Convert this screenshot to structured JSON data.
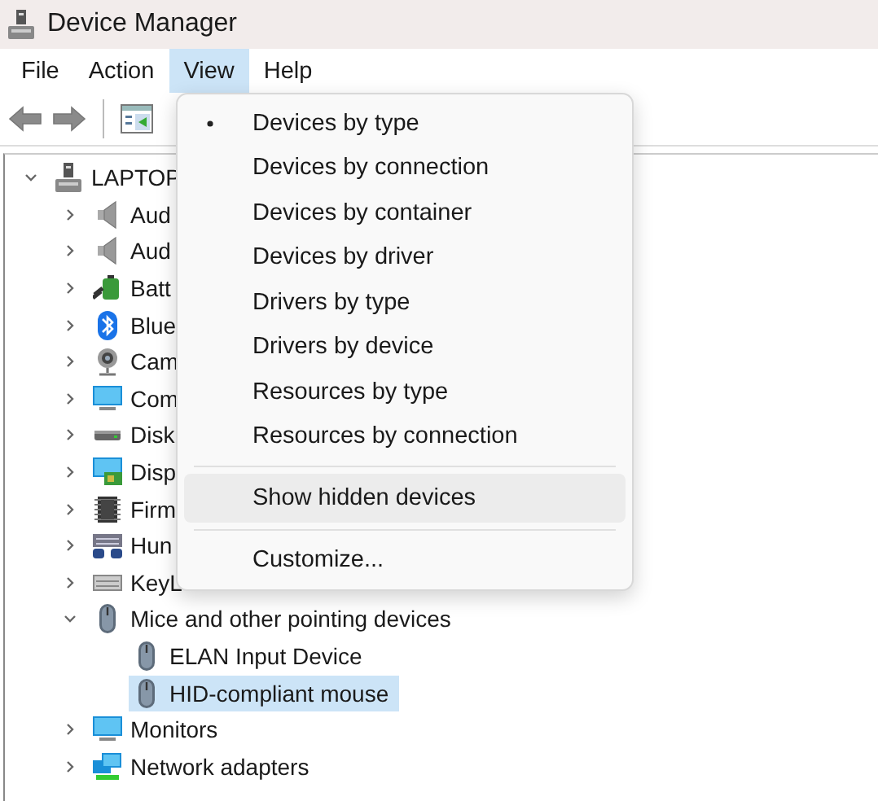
{
  "window": {
    "title": "Device Manager"
  },
  "menu_bar": [
    {
      "label": "File",
      "selected": false
    },
    {
      "label": "Action",
      "selected": false
    },
    {
      "label": "View",
      "selected": true
    },
    {
      "label": "Help",
      "selected": false
    }
  ],
  "toolbar": [
    {
      "kind": "back",
      "disabled": false
    },
    {
      "kind": "forward",
      "disabled": false
    },
    {
      "kind": "separator"
    },
    {
      "kind": "properties",
      "disabled": false
    }
  ],
  "tree": {
    "label": "LAPTOP",
    "kind": "computer",
    "expanded": true,
    "selected": false,
    "children": [
      {
        "label": "Aud",
        "kind": "speaker",
        "expanded": false,
        "selected": false
      },
      {
        "label": "Aud",
        "kind": "speaker",
        "expanded": false,
        "selected": false
      },
      {
        "label": "Batt",
        "kind": "battery",
        "expanded": false,
        "selected": false
      },
      {
        "label": "Blue",
        "kind": "bluetooth",
        "expanded": false,
        "selected": false
      },
      {
        "label": "Cam",
        "kind": "camera",
        "expanded": false,
        "selected": false
      },
      {
        "label": "Com",
        "kind": "monitor",
        "expanded": false,
        "selected": false
      },
      {
        "label": "Disk",
        "kind": "disk",
        "expanded": false,
        "selected": false
      },
      {
        "label": "Disp",
        "kind": "display-adapter",
        "expanded": false,
        "selected": false
      },
      {
        "label": "Firm",
        "kind": "chip",
        "expanded": false,
        "selected": false
      },
      {
        "label": "Hun",
        "kind": "hid",
        "expanded": false,
        "selected": false
      },
      {
        "label": "KeyL",
        "kind": "keyboard",
        "expanded": false,
        "selected": false
      },
      {
        "label": "Mice and other pointing devices",
        "kind": "mouse",
        "expanded": true,
        "selected": false,
        "children": [
          {
            "label": "ELAN Input Device",
            "kind": "mouse",
            "selected": false
          },
          {
            "label": "HID-compliant mouse",
            "kind": "mouse",
            "selected": true
          }
        ]
      },
      {
        "label": "Monitors",
        "kind": "monitor",
        "expanded": false,
        "selected": false
      },
      {
        "label": "Network adapters",
        "kind": "network",
        "expanded": false,
        "selected": false
      }
    ]
  },
  "view_menu": [
    {
      "kind": "item",
      "label": "Devices by type",
      "checked": true,
      "hovered": false
    },
    {
      "kind": "item",
      "label": "Devices by connection",
      "checked": false,
      "hovered": false
    },
    {
      "kind": "item",
      "label": "Devices by container",
      "checked": false,
      "hovered": false
    },
    {
      "kind": "item",
      "label": "Devices by driver",
      "checked": false,
      "hovered": false
    },
    {
      "kind": "item",
      "label": "Drivers by type",
      "checked": false,
      "hovered": false
    },
    {
      "kind": "item",
      "label": "Drivers by device",
      "checked": false,
      "hovered": false
    },
    {
      "kind": "item",
      "label": "Resources by type",
      "checked": false,
      "hovered": false
    },
    {
      "kind": "item",
      "label": "Resources by connection",
      "checked": false,
      "hovered": false
    },
    {
      "kind": "separator"
    },
    {
      "kind": "item",
      "label": "Show hidden devices",
      "checked": false,
      "hovered": true
    },
    {
      "kind": "separator"
    },
    {
      "kind": "item",
      "label": "Customize...",
      "checked": false,
      "hovered": false
    }
  ]
}
